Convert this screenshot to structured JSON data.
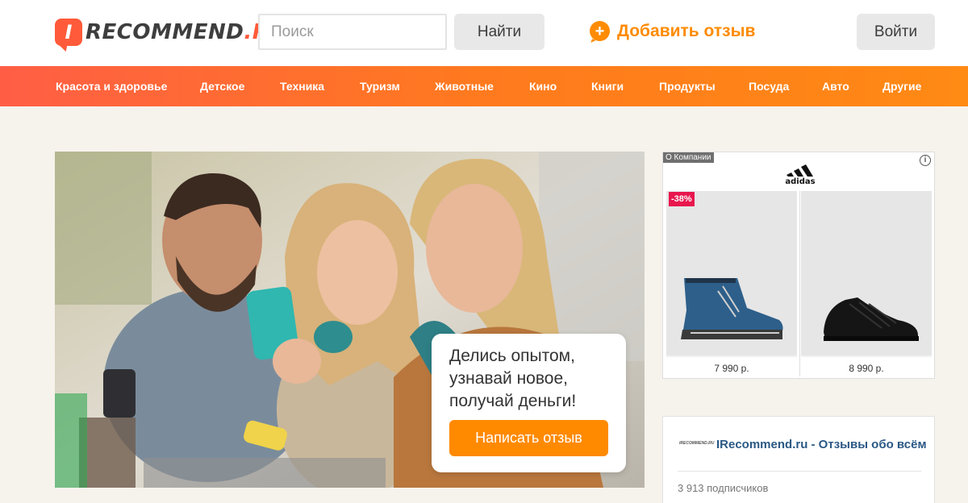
{
  "header": {
    "logo_badge": "I",
    "logo_main": "RECOMMEND",
    "logo_domain": ".RU",
    "search_placeholder": "Поиск",
    "search_button": "Найти",
    "add_review": "Добавить отзыв",
    "login_button": "Войти"
  },
  "nav": {
    "items": [
      "Красота и здоровье",
      "Детское",
      "Техника",
      "Туризм",
      "Животные",
      "Кино",
      "Книги",
      "Продукты",
      "Посуда",
      "Авто",
      "Другие"
    ]
  },
  "hero": {
    "card_text": "Делись опытом, узнавай новое, получай деньги!",
    "cta_button": "Написать отзыв"
  },
  "ad": {
    "label": "О Компании",
    "info_icon": "i",
    "brand": "adidas",
    "products": [
      {
        "price": "7 990 р.",
        "discount": "-38%",
        "icon": "boot-image"
      },
      {
        "price": "8 990 р.",
        "discount": "",
        "icon": "sneaker-image"
      }
    ]
  },
  "widget": {
    "logo_text": "IRECOMMEND.RU",
    "title": "IRecommend.ru - Отзывы обо всём",
    "subscribers": "3 913 подписчиков"
  },
  "colors": {
    "brand": "#ff5b3a",
    "accent": "#ff8a00",
    "nav_gradient_start": "#ff5e45",
    "nav_gradient_end": "#ff8a14",
    "link": "#2a5885"
  }
}
